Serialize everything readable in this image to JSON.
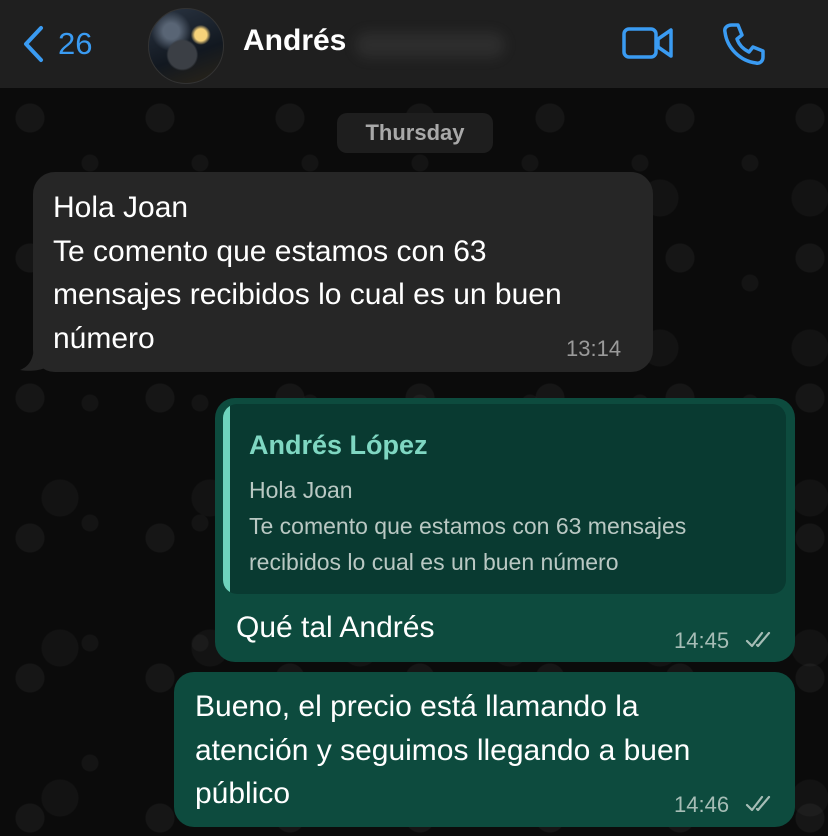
{
  "header": {
    "back_count": "26",
    "contact_name": "Andrés",
    "accent_color": "#3a9bf2"
  },
  "chat": {
    "day_separator": "Thursday",
    "incoming": {
      "lines": [
        "Hola Joan",
        "Te comento que estamos con 63",
        "mensajes recibidos lo cual es un buen",
        "número"
      ],
      "time": "13:14"
    },
    "outgoing_reply": {
      "quote_author": "Andrés López",
      "quote_lines": [
        "Hola Joan",
        "Te comento que estamos con 63 mensajes",
        "recibidos lo cual es un buen número"
      ],
      "text": "Qué tal Andrés",
      "time": "14:45",
      "status_icon": "double-check-icon"
    },
    "outgoing_second": {
      "lines": [
        "Bueno, el precio está llamando la",
        "atención y seguimos llegando a buen",
        "público"
      ],
      "time": "14:46",
      "status_icon": "double-check-icon"
    }
  }
}
